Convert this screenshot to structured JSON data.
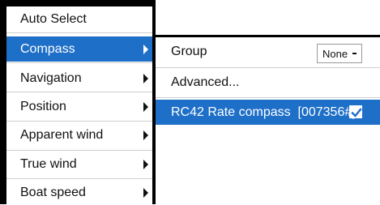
{
  "main_menu": {
    "items": [
      {
        "label": "Auto Select",
        "arrow": false
      },
      {
        "label": "Compass",
        "arrow": true,
        "selected": true
      },
      {
        "label": "Navigation",
        "arrow": true
      },
      {
        "label": "Position",
        "arrow": true
      },
      {
        "label": "Apparent wind",
        "arrow": true
      },
      {
        "label": "True wind",
        "arrow": true
      },
      {
        "label": "Boat speed",
        "arrow": true
      }
    ]
  },
  "submenu": {
    "group_label": "Group",
    "group_value": "None",
    "advanced_label": "Advanced...",
    "device_label": "RC42 Rate compass  [007356#]",
    "device_checked": true
  },
  "colors": {
    "accent": "#1e6fc8",
    "frame": "#000000"
  },
  "icons": [
    "chevron-right-icon",
    "dropdown-caret-icon",
    "checkmark-icon"
  ]
}
